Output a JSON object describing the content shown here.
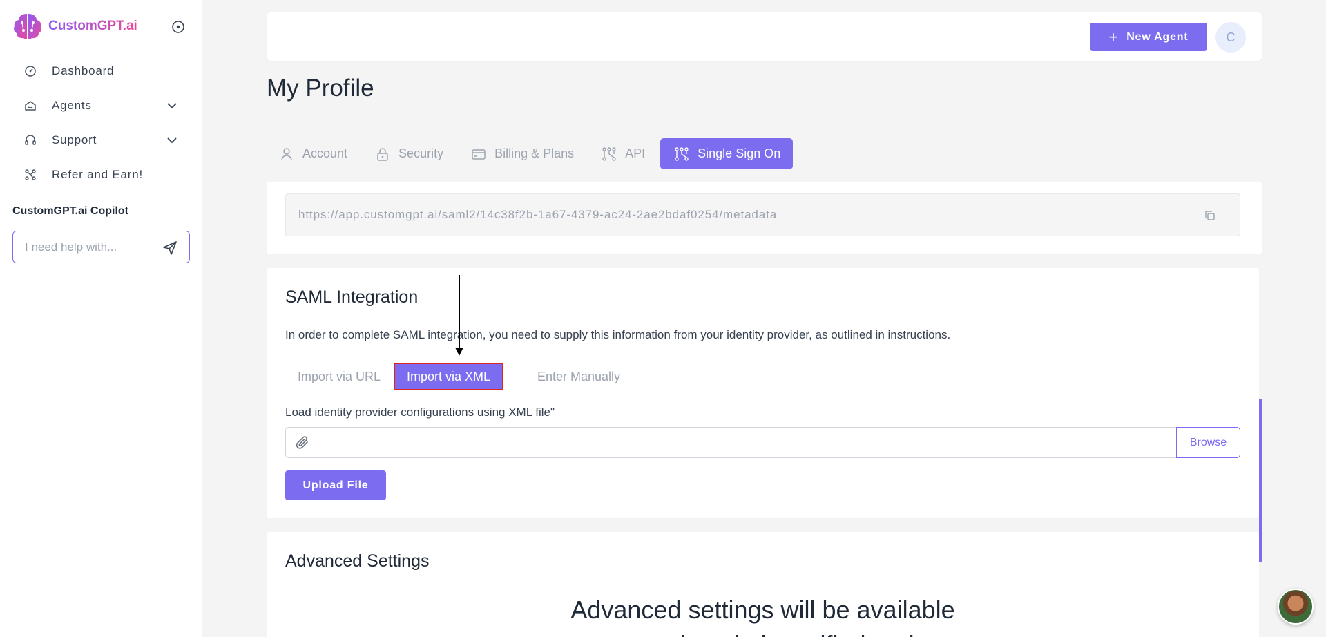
{
  "brand": {
    "name": "CustomGPT.ai"
  },
  "sidebar": {
    "items": [
      {
        "label": "Dashboard",
        "icon": "dashboard-icon"
      },
      {
        "label": "Agents",
        "icon": "agents-icon",
        "expandable": true
      },
      {
        "label": "Support",
        "icon": "headset-icon",
        "expandable": true
      },
      {
        "label": "Refer and Earn!",
        "icon": "share-icon"
      }
    ],
    "copilot": {
      "title": "CustomGPT.ai Copilot",
      "placeholder": "I need help with..."
    }
  },
  "header": {
    "new_agent_label": "New Agent",
    "avatar_initial": "C"
  },
  "page": {
    "title": "My Profile"
  },
  "tabs": [
    {
      "label": "Account",
      "icon": "user-icon",
      "active": false
    },
    {
      "label": "Security",
      "icon": "lock-icon",
      "active": false
    },
    {
      "label": "Billing & Plans",
      "icon": "card-icon",
      "active": false
    },
    {
      "label": "API",
      "icon": "api-icon",
      "active": false
    },
    {
      "label": "Single Sign On",
      "icon": "sso-icon",
      "active": true
    }
  ],
  "sso": {
    "metadata_url": "https://app.customgpt.ai/saml2/14c38f2b-1a67-4379-ac24-2ae2bdaf0254/metadata"
  },
  "saml": {
    "title": "SAML Integration",
    "description": "In order to complete SAML integration, you need to supply this information from your identity provider, as outlined in instructions.",
    "subtabs": [
      {
        "label": "Import via URL",
        "active": false
      },
      {
        "label": "Import via XML",
        "active": true
      },
      {
        "label": "Enter Manually",
        "active": false
      }
    ],
    "load_label": "Load identity provider configurations using XML file\"",
    "browse_label": "Browse",
    "upload_label": "Upload File"
  },
  "advanced": {
    "title": "Advanced Settings",
    "message_line1": "Advanced settings will be available",
    "message_line2": "once domain is verified and"
  },
  "colors": {
    "accent": "#7c6cf0",
    "highlight": "#dc2626"
  }
}
